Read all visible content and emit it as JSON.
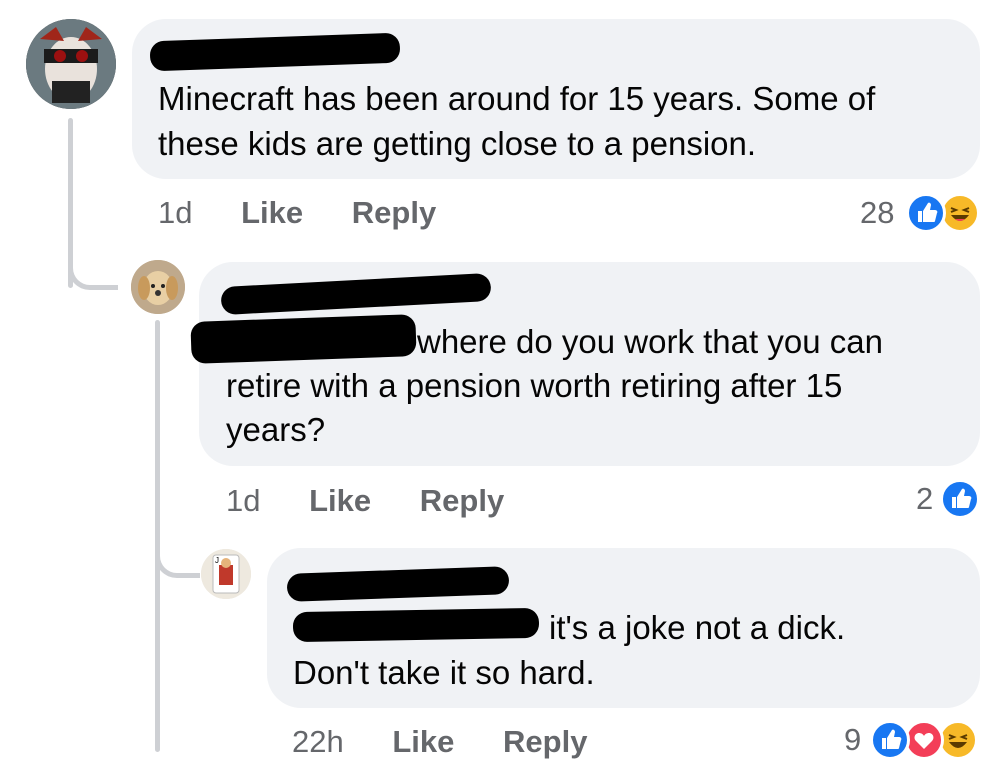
{
  "comments": [
    {
      "text_line1": "Minecraft has been around for 15 years. Some of",
      "text_line2": "these kids are getting close to a pension.",
      "time": "1d",
      "like_label": "Like",
      "reply_label": "Reply",
      "reaction_count": "28",
      "reactions": [
        "like-icon",
        "haha-icon"
      ]
    },
    {
      "text_line1": "where do you work that you can",
      "text_line2": "retire with a pension worth retiring after 15",
      "text_line3": "years?",
      "time": "1d",
      "like_label": "Like",
      "reply_label": "Reply",
      "reaction_count": "2",
      "reactions": [
        "like-icon"
      ]
    },
    {
      "text_line1": "it's a joke not a dick.",
      "text_line2": "Don't take it so hard.",
      "time": "22h",
      "like_label": "Like",
      "reply_label": "Reply",
      "reaction_count": "9",
      "reactions": [
        "like-icon",
        "love-icon",
        "haha-icon"
      ]
    }
  ],
  "colors": {
    "like": "#1877f2",
    "love": "#f33e58",
    "haha": "#f7b928",
    "bubble": "#f0f2f5",
    "meta": "#65676b",
    "mention": "#1877f2"
  }
}
